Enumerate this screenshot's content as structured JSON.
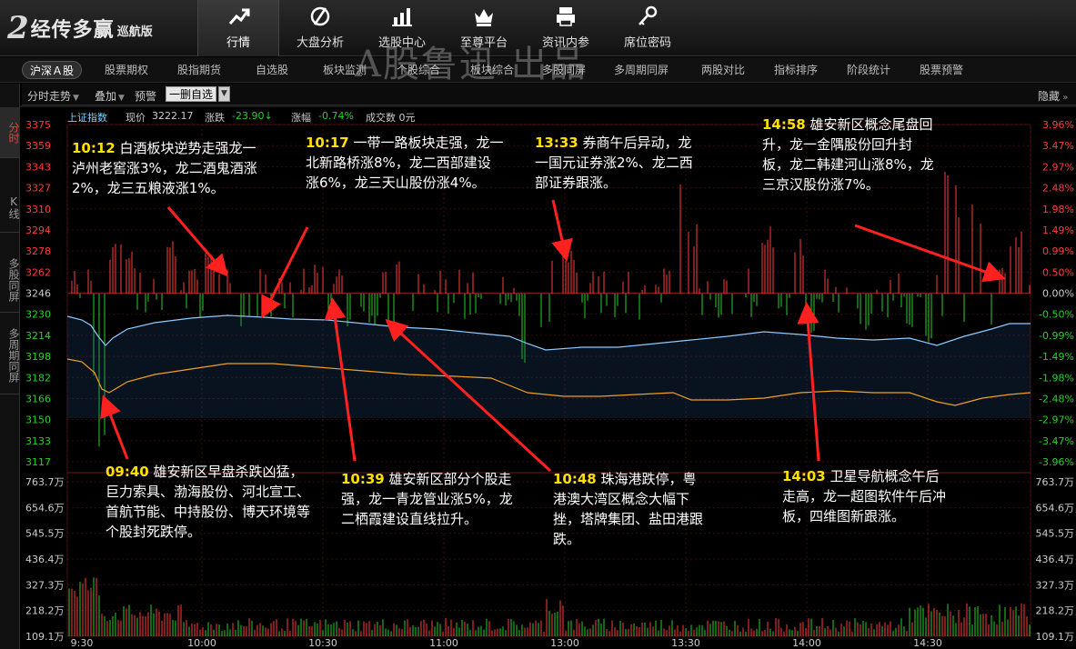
{
  "logo": {
    "mark": "2",
    "brand": "经传多赢",
    "edition": "巡航版"
  },
  "nav": [
    {
      "label": "行情",
      "icon": "chart-trend-icon"
    },
    {
      "label": "大盘分析",
      "icon": "no-sign-icon"
    },
    {
      "label": "选股中心",
      "icon": "bar-chart-icon"
    },
    {
      "label": "至尊平台",
      "icon": "crown-icon"
    },
    {
      "label": "资讯内参",
      "icon": "printer-icon"
    },
    {
      "label": "席位密码",
      "icon": "key-icon"
    }
  ],
  "subtabs": [
    "沪深Ａ股",
    "股票期权",
    "股指期货",
    "自选股",
    "板块监测",
    "个股综合",
    "板块综合",
    "多股同屏",
    "多周期同屏",
    "两股对比",
    "指标排序",
    "阶段统计",
    "股票预警"
  ],
  "watermark": "A股鲁迅 出品",
  "toolbar": {
    "timeshare": "分时走势",
    "overlay": "叠加",
    "alert": "预警",
    "select": "一删自选",
    "hide": "隐藏"
  },
  "vtabs": [
    "分时",
    "K线",
    "多股同屏",
    "多周期同屏"
  ],
  "info": {
    "index": "上证指数",
    "price_label": "现价",
    "price": "3222.17",
    "change_label": "涨跌",
    "change": "-23.90",
    "pct_label": "涨幅",
    "pct": "-0.74%",
    "amount": "成交数 0元"
  },
  "axis": {
    "prices": [
      "3375",
      "3359",
      "3343",
      "3327",
      "3310",
      "3294",
      "3278",
      "3262",
      "3246",
      "3230",
      "3214",
      "3198",
      "3182",
      "3166",
      "3150",
      "3133",
      "3117"
    ],
    "pcts": [
      "3.96%",
      "3.47%",
      "2.97%",
      "2.48%",
      "1.98%",
      "1.49%",
      "0.99%",
      "0.50%",
      "0.00%",
      "-0.50%",
      "-0.99%",
      "-1.49%",
      "-1.98%",
      "-2.48%",
      "-2.97%",
      "-3.47%",
      "-3.96%"
    ],
    "volumes": [
      "763.7万",
      "654.6万",
      "545.5万",
      "436.4万",
      "327.3万",
      "218.2万",
      "109.1万"
    ],
    "times": [
      "9:30",
      "10:00",
      "10:30",
      "11:00",
      "13:00",
      "13:30",
      "14:00",
      "14:30"
    ]
  },
  "colors": {
    "up": "#ff3a3a",
    "down": "#27d127",
    "price_line": "#8ec9ff",
    "avg_line": "#f0a020",
    "note_time": "#ffe000",
    "arrow": "#ff2020"
  },
  "annotations": [
    {
      "time": "10:12",
      "text": "白酒板块逆势走强龙一泸州老窖涨3%，龙二酒鬼酒涨2%，龙三五粮液涨1%。"
    },
    {
      "time": "10:17",
      "text": "一带一路板块走强，龙一北新路桥涨8%，龙二西部建设涨6%，龙三天山股份涨4%。"
    },
    {
      "time": "13:33",
      "text": "券商午后异动，龙一国元证券涨2%、龙二西部证券跟涨。"
    },
    {
      "time": "14:58",
      "text": "雄安新区概念尾盘回升，龙一金隅股份回升封板，龙二韩建河山涨8%，龙三京汉股份涨7%。"
    },
    {
      "time": "09:40",
      "text": "雄安新区早盘杀跌凶猛，巨力索具、渤海股份、河北宣工、首航节能、中持股份、博天环境等个股封死跌停。"
    },
    {
      "time": "10:39",
      "text": "雄安新区部分个股走强，龙一青龙管业涨5%，龙二栖霞建设直线拉升。"
    },
    {
      "time": "10:48",
      "text": "珠海港跌停，粤港澳大湾区概念大幅下挫，塔牌集团、盐田港跟跌。"
    },
    {
      "time": "14:03",
      "text": "卫星导航概念午后走高，龙一超图软件午后冲板，四维图新跟涨。"
    }
  ]
}
